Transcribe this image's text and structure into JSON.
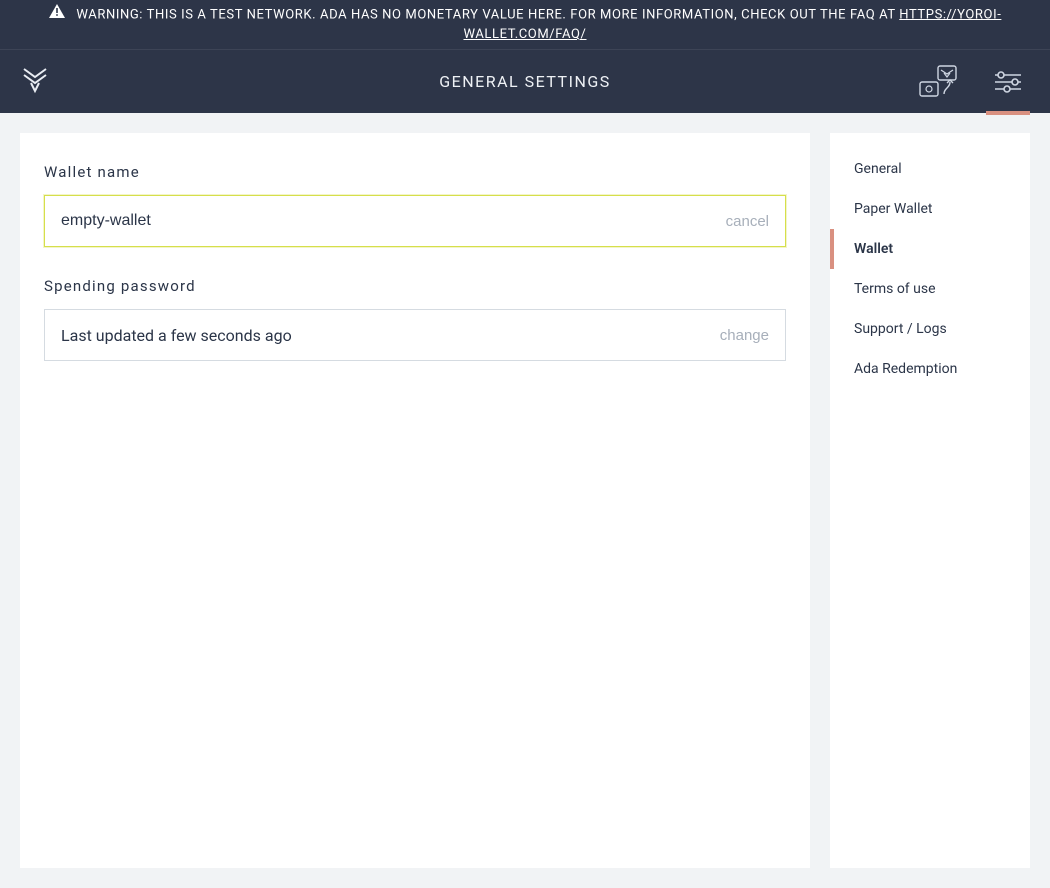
{
  "banner": {
    "text": "WARNING: THIS IS A TEST NETWORK. ADA HAS NO MONETARY VALUE HERE. FOR MORE INFORMATION, CHECK OUT THE FAQ AT ",
    "link_text": "HTTPS://YOROI-WALLET.COM/FAQ/"
  },
  "header": {
    "title": "GENERAL SETTINGS"
  },
  "form": {
    "wallet_name_label": "Wallet name",
    "wallet_name_value": "empty-wallet",
    "wallet_name_cancel": "cancel",
    "spending_password_label": "Spending password",
    "spending_password_status": "Last updated a few seconds ago",
    "spending_password_change": "change"
  },
  "sidebar": {
    "items": [
      {
        "label": "General",
        "active": false
      },
      {
        "label": "Paper Wallet",
        "active": false
      },
      {
        "label": "Wallet",
        "active": true
      },
      {
        "label": "Terms of use",
        "active": false
      },
      {
        "label": "Support / Logs",
        "active": false
      },
      {
        "label": "Ada Redemption",
        "active": false
      }
    ]
  }
}
